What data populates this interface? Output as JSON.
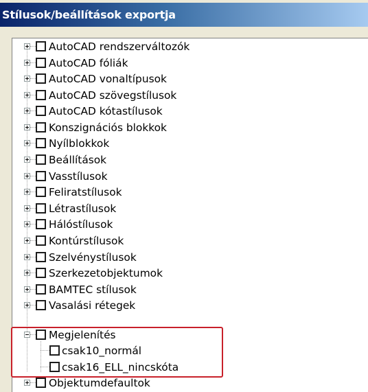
{
  "window": {
    "title": "Stílusok/beállítások exportja"
  },
  "tree": {
    "items": [
      {
        "label": "AutoCAD rendszerváltozók",
        "expander": "plus"
      },
      {
        "label": "AutoCAD fóliák",
        "expander": "plus"
      },
      {
        "label": "AutoCAD vonaltípusok",
        "expander": "plus"
      },
      {
        "label": "AutoCAD szövegstílusok",
        "expander": "plus"
      },
      {
        "label": "AutoCAD kótastílusok",
        "expander": "plus"
      },
      {
        "label": "Konszignációs blokkok",
        "expander": "plus"
      },
      {
        "label": "Nyílblokkok",
        "expander": "plus"
      },
      {
        "label": "Beállítások",
        "expander": "plus"
      },
      {
        "label": "Vasstílusok",
        "expander": "plus"
      },
      {
        "label": "Feliratstílusok",
        "expander": "plus"
      },
      {
        "label": "Létrastílusok",
        "expander": "plus"
      },
      {
        "label": "Hálóstílusok",
        "expander": "plus"
      },
      {
        "label": "Kontúrstílusok",
        "expander": "plus"
      },
      {
        "label": "Szelvénystílusok",
        "expander": "plus"
      },
      {
        "label": "Szerkezetobjektumok",
        "expander": "plus"
      },
      {
        "label": "BAMTEC stílusok",
        "expander": "plus"
      },
      {
        "label": "Vasalási rétegek",
        "expander": "plus"
      },
      {
        "label": "Megjelenítés",
        "expander": "minus",
        "children": [
          {
            "label": "csak10_normál"
          },
          {
            "label": "csak16_ELL_nincskóta"
          }
        ]
      },
      {
        "label": "Objektumdefaultok",
        "expander": "plus"
      }
    ]
  },
  "colors": {
    "title_gradient_start": "#0a246a",
    "title_gradient_end": "#a6caf0",
    "highlight_box": "#c8202a",
    "dialog_background": "#ece9d8"
  }
}
